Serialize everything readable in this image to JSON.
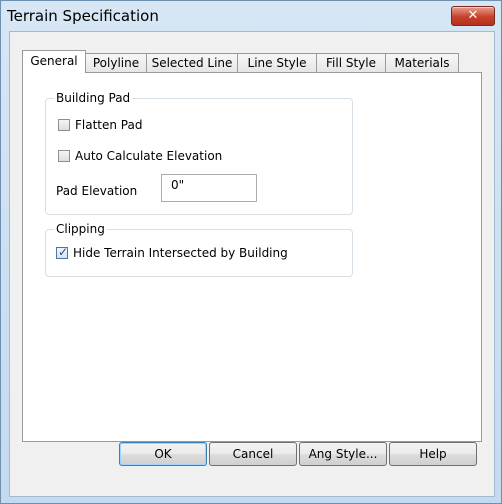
{
  "window": {
    "title": "Terrain Specification",
    "close_glyph": "✕"
  },
  "tabs": [
    {
      "label": "General",
      "active": true
    },
    {
      "label": "Polyline",
      "active": false
    },
    {
      "label": "Selected Line",
      "active": false
    },
    {
      "label": "Line Style",
      "active": false
    },
    {
      "label": "Fill Style",
      "active": false
    },
    {
      "label": "Materials",
      "active": false
    }
  ],
  "building_pad": {
    "group_label": "Building Pad",
    "flatten_pad": {
      "label": "Flatten Pad",
      "checked": false
    },
    "auto_calc": {
      "label": "Auto Calculate Elevation",
      "checked": false
    },
    "pad_elevation": {
      "label": "Pad Elevation",
      "value": "0\""
    }
  },
  "clipping": {
    "group_label": "Clipping",
    "hide_terrain": {
      "label": "Hide Terrain Intersected by Building",
      "checked": true
    }
  },
  "buttons": {
    "ok": "OK",
    "cancel": "Cancel",
    "ang_style": "Ang Style...",
    "help": "Help"
  },
  "colors": {
    "title_bar": "#c9dff2",
    "close_button": "#c7402a",
    "check": "#2a4d7a"
  }
}
